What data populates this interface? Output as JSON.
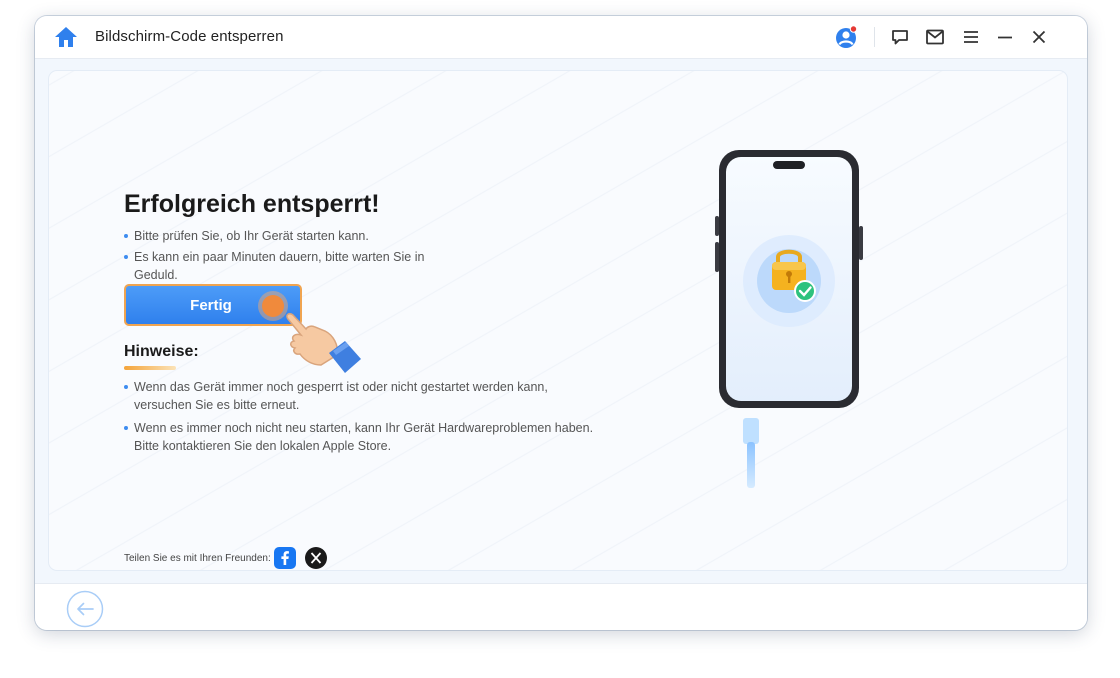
{
  "window": {
    "title": "Bildschirm-Code entsperren",
    "controls": [
      "home-icon",
      "avatar-icon",
      "feedback-icon",
      "mail-icon",
      "menu-icon",
      "minimize-icon",
      "close-icon"
    ]
  },
  "main": {
    "heading": "Erfolgreich entsperrt!",
    "bullets": [
      "Bitte prüfen Sie, ob Ihr Gerät starten kann.",
      "Es kann ein paar Minuten dauern, bitte warten Sie in Geduld."
    ],
    "done_label": "Fertig",
    "hints_title": "Hinweise:",
    "hints": [
      "Wenn das Gerät immer noch gesperrt ist oder nicht gestartet werden kann, versuchen Sie es bitte erneut.",
      "Wenn es immer noch nicht neu starten, kann Ihr Gerät  Hardwareproblemen haben. Bitte kontaktieren Sie den lokalen Apple Store."
    ],
    "share_label": "Teilen Sie es mit Ihren Freunden:",
    "share_icons": [
      "facebook-icon",
      "x-icon"
    ]
  },
  "colors": {
    "accent": "#2f80ed",
    "button_border": "#f0a450",
    "notification_dot": "#e53935",
    "success": "#2ec27e",
    "lock": "#f5a623"
  },
  "bottom": {
    "back_icon": "arrow-left-icon"
  }
}
